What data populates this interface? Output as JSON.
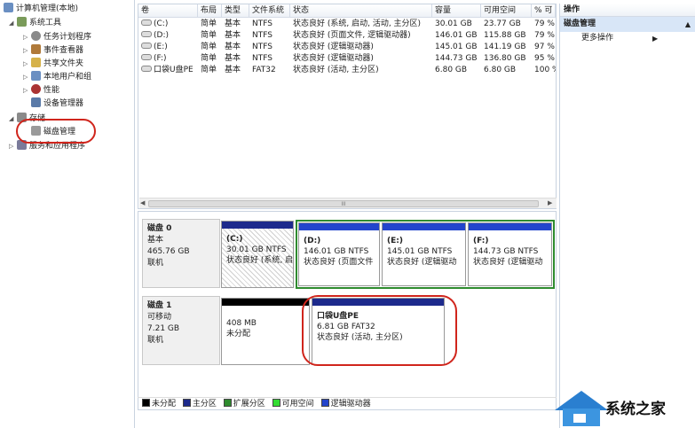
{
  "tree": [
    {
      "label": "计算机管理(本地)",
      "icon": "computer-icon",
      "color": "#6a8fc2"
    },
    {
      "label": "系统工具",
      "icon": "tools-icon",
      "color": "#7a9b5a"
    },
    {
      "label": "任务计划程序",
      "icon": "clock-icon",
      "color": "#8a8a8a"
    },
    {
      "label": "事件查看器",
      "icon": "event-viewer-icon",
      "color": "#b07a3a"
    },
    {
      "label": "共享文件夹",
      "icon": "shared-folder-icon",
      "color": "#d6b24a"
    },
    {
      "label": "本地用户和组",
      "icon": "users-icon",
      "color": "#6a8fc2"
    },
    {
      "label": "性能",
      "icon": "performance-icon",
      "color": "#aa3333"
    },
    {
      "label": "设备管理器",
      "icon": "device-manager-icon",
      "color": "#5a7aa8"
    },
    {
      "label": "存储",
      "icon": "storage-icon",
      "color": "#8a8a8a"
    },
    {
      "label": "磁盘管理",
      "icon": "disk-icon",
      "color": "#9a9a9a"
    },
    {
      "label": "服务和应用程序",
      "icon": "services-icon",
      "color": "#7a7a9a"
    }
  ],
  "columns": [
    "卷",
    "布局",
    "类型",
    "文件系统",
    "状态",
    "容量",
    "可用空间",
    "% 可"
  ],
  "rows": [
    [
      "(C:)",
      "简单",
      "基本",
      "NTFS",
      "状态良好 (系统, 启动, 活动, 主分区)",
      "30.01 GB",
      "23.77 GB",
      "79 %"
    ],
    [
      "(D:)",
      "简单",
      "基本",
      "NTFS",
      "状态良好 (页面文件, 逻辑驱动器)",
      "146.01 GB",
      "115.88 GB",
      "79 %"
    ],
    [
      "(E:)",
      "简单",
      "基本",
      "NTFS",
      "状态良好 (逻辑驱动器)",
      "145.01 GB",
      "141.19 GB",
      "97 %"
    ],
    [
      "(F:)",
      "简单",
      "基本",
      "NTFS",
      "状态良好 (逻辑驱动器)",
      "144.73 GB",
      "136.80 GB",
      "95 %"
    ],
    [
      "口袋U盘PE",
      "简单",
      "基本",
      "FAT32",
      "状态良好 (活动, 主分区)",
      "6.80 GB",
      "6.80 GB",
      "100 %"
    ]
  ],
  "scroll_glyph": "III",
  "disk0": {
    "name": "磁盘 0",
    "type": "基本",
    "size": "465.76 GB",
    "status": "联机",
    "parts": [
      {
        "name": "(C:)",
        "size": "30.01 GB NTFS",
        "status": "状态良好 (系统, 启",
        "bar": "#1d2a8c"
      },
      {
        "name": "(D:)",
        "size": "146.01 GB NTFS",
        "status": "状态良好 (页面文件",
        "bar": "#2244cc"
      },
      {
        "name": "(E:)",
        "size": "145.01 GB NTFS",
        "status": "状态良好 (逻辑驱动",
        "bar": "#2244cc"
      },
      {
        "name": "(F:)",
        "size": "144.73 GB NTFS",
        "status": "状态良好 (逻辑驱动",
        "bar": "#2244cc"
      }
    ]
  },
  "disk1": {
    "name": "磁盘 1",
    "type": "可移动",
    "size": "7.21 GB",
    "status": "联机",
    "parts": [
      {
        "name": "",
        "size": "408 MB",
        "status": "未分配",
        "bar": "#000000"
      },
      {
        "name": "口袋U盘PE",
        "size": "6.81 GB FAT32",
        "status": "状态良好 (活动, 主分区)",
        "bar": "#1d2a8c"
      }
    ]
  },
  "legend": [
    {
      "label": "未分配",
      "color": "#000000"
    },
    {
      "label": "主分区",
      "color": "#1d2a8c"
    },
    {
      "label": "扩展分区",
      "color": "#2e8b2e"
    },
    {
      "label": "可用空间",
      "color": "#33dd33"
    },
    {
      "label": "逻辑驱动器",
      "color": "#2244cc"
    }
  ],
  "actions": {
    "title": "操作",
    "section": "磁盘管理",
    "more": "更多操作"
  },
  "watermark": "系统之家"
}
